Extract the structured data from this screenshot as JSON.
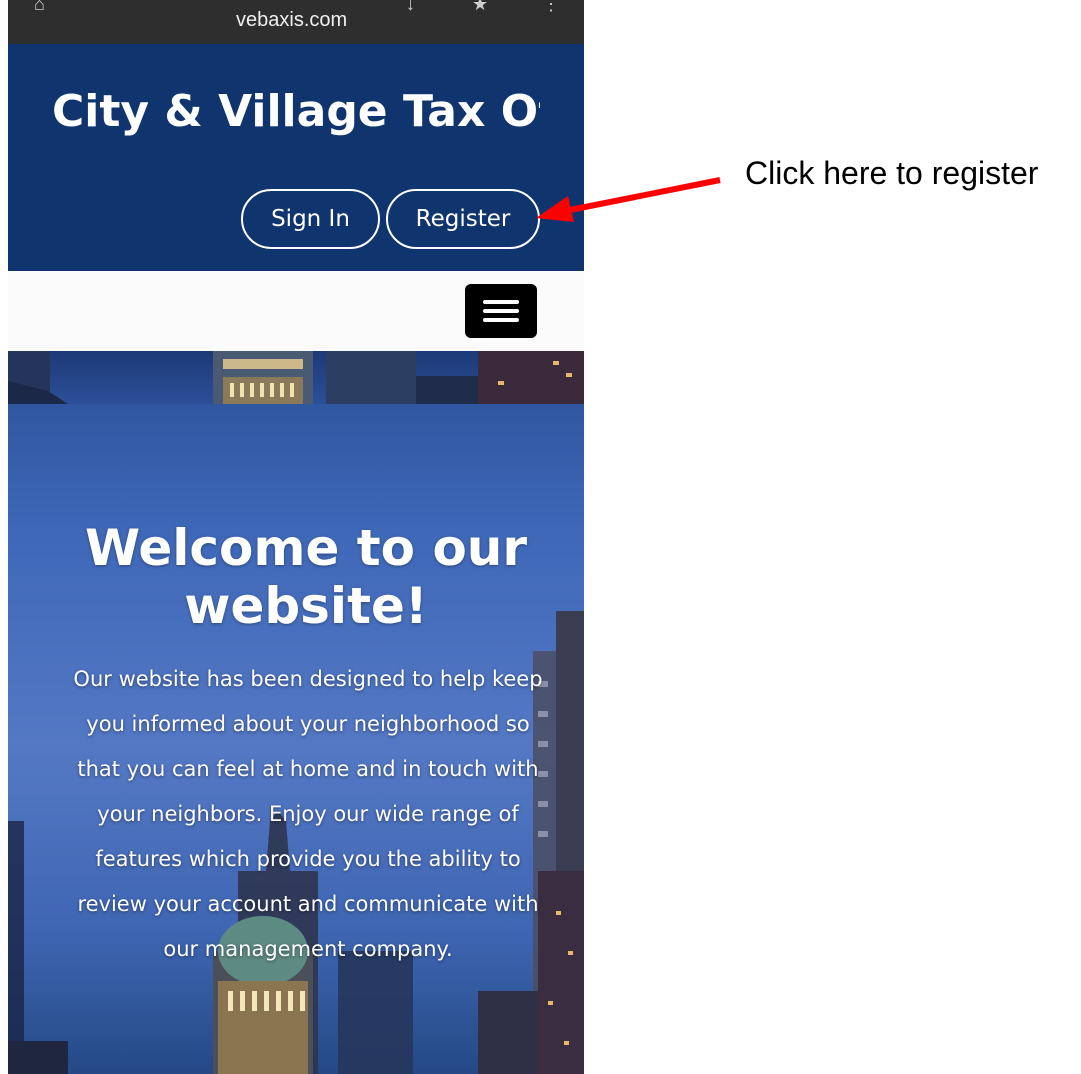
{
  "browser": {
    "url": "vebaxis.com"
  },
  "header": {
    "site_title": "City & Village Tax Of"
  },
  "nav": {
    "sign_in_label": "Sign In",
    "register_label": "Register",
    "menu_icon": "hamburger-menu-icon"
  },
  "hero": {
    "title": "Welcome to our website!",
    "body": "Our website has been designed to help keep you informed about your neighborhood so that you can feel at home and in touch with your neighbors. Enjoy our wide range of features which provide you the ability to review your account and communicate with our management company."
  },
  "annotation": {
    "text": "Click here to register",
    "arrow_color": "#ff0000"
  },
  "colors": {
    "header_bg": "#10356e",
    "browser_bar_bg": "#2e2e2e"
  }
}
